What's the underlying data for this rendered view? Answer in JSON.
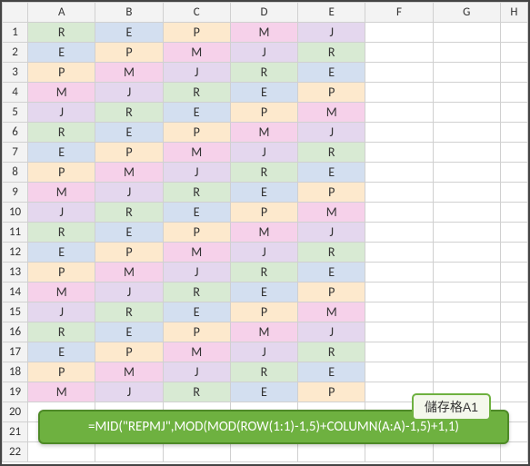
{
  "columns": [
    "A",
    "B",
    "C",
    "D",
    "E",
    "F",
    "G",
    "H"
  ],
  "rows": [
    "1",
    "2",
    "3",
    "4",
    "5",
    "6",
    "7",
    "8",
    "9",
    "10",
    "11",
    "12",
    "13",
    "14",
    "15",
    "16",
    "17",
    "18",
    "19",
    "20",
    "21",
    "22"
  ],
  "chart_data": {
    "type": "table",
    "title": "",
    "columns": [
      "A",
      "B",
      "C",
      "D",
      "E"
    ],
    "row_labels": [
      "1",
      "2",
      "3",
      "4",
      "5",
      "6",
      "7",
      "8",
      "9",
      "10",
      "11",
      "12",
      "13",
      "14",
      "15",
      "16",
      "17",
      "18",
      "19"
    ],
    "values": [
      [
        "R",
        "E",
        "P",
        "M",
        "J"
      ],
      [
        "E",
        "P",
        "M",
        "J",
        "R"
      ],
      [
        "P",
        "M",
        "J",
        "R",
        "E"
      ],
      [
        "M",
        "J",
        "R",
        "E",
        "P"
      ],
      [
        "J",
        "R",
        "E",
        "P",
        "M"
      ],
      [
        "R",
        "E",
        "P",
        "M",
        "J"
      ],
      [
        "E",
        "P",
        "M",
        "J",
        "R"
      ],
      [
        "P",
        "M",
        "J",
        "R",
        "E"
      ],
      [
        "M",
        "J",
        "R",
        "E",
        "P"
      ],
      [
        "J",
        "R",
        "E",
        "P",
        "M"
      ],
      [
        "R",
        "E",
        "P",
        "M",
        "J"
      ],
      [
        "E",
        "P",
        "M",
        "J",
        "R"
      ],
      [
        "P",
        "M",
        "J",
        "R",
        "E"
      ],
      [
        "M",
        "J",
        "R",
        "E",
        "P"
      ],
      [
        "J",
        "R",
        "E",
        "P",
        "M"
      ],
      [
        "R",
        "E",
        "P",
        "M",
        "J"
      ],
      [
        "E",
        "P",
        "M",
        "J",
        "R"
      ],
      [
        "P",
        "M",
        "J",
        "R",
        "E"
      ],
      [
        "M",
        "J",
        "R",
        "E",
        "P"
      ]
    ],
    "fills": [
      [
        "c-green",
        "c-blue",
        "c-yellow",
        "c-pink",
        "c-lav"
      ],
      [
        "c-blue",
        "c-yellow",
        "c-pink",
        "c-lav",
        "c-green"
      ],
      [
        "c-yellow",
        "c-pink",
        "c-lav",
        "c-green",
        "c-blue"
      ],
      [
        "c-pink",
        "c-lav",
        "c-green",
        "c-blue",
        "c-yellow"
      ],
      [
        "c-lav",
        "c-green",
        "c-blue",
        "c-yellow",
        "c-pink"
      ],
      [
        "c-green",
        "c-blue",
        "c-yellow",
        "c-pink",
        "c-lav"
      ],
      [
        "c-blue",
        "c-yellow",
        "c-pink",
        "c-lav",
        "c-green"
      ],
      [
        "c-yellow",
        "c-pink",
        "c-lav",
        "c-green",
        "c-blue"
      ],
      [
        "c-pink",
        "c-lav",
        "c-green",
        "c-blue",
        "c-yellow"
      ],
      [
        "c-lav",
        "c-green",
        "c-blue",
        "c-yellow",
        "c-pink"
      ],
      [
        "c-green",
        "c-blue",
        "c-yellow",
        "c-pink",
        "c-lav"
      ],
      [
        "c-blue",
        "c-yellow",
        "c-pink",
        "c-lav",
        "c-green"
      ],
      [
        "c-yellow",
        "c-pink",
        "c-lav",
        "c-green",
        "c-blue"
      ],
      [
        "c-pink",
        "c-lav",
        "c-green",
        "c-blue",
        "c-yellow"
      ],
      [
        "c-lav",
        "c-green",
        "c-blue",
        "c-yellow",
        "c-pink"
      ],
      [
        "c-green",
        "c-blue",
        "c-yellow",
        "c-pink",
        "c-lav"
      ],
      [
        "c-blue",
        "c-yellow",
        "c-pink",
        "c-lav",
        "c-green"
      ],
      [
        "c-yellow",
        "c-pink",
        "c-lav",
        "c-green",
        "c-blue"
      ],
      [
        "c-pink",
        "c-lav",
        "c-green",
        "c-blue",
        "c-yellow"
      ]
    ]
  },
  "callout": {
    "tag": "儲存格A1",
    "formula": "=MID(\"REPMJ\",MOD(MOD(ROW(1:1)-1,5)+COLUMN(A:A)-1,5)+1,1)"
  }
}
